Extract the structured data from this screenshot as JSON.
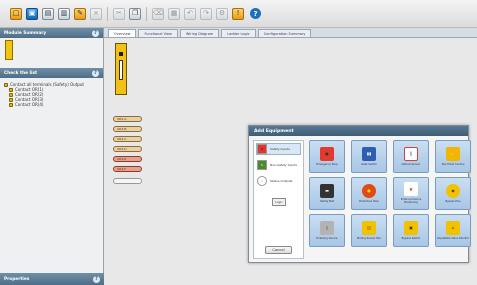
{
  "toolbar": {
    "buttons": [
      "new-project",
      "save",
      "open",
      "print",
      "rename",
      "close",
      "cut",
      "copy",
      "delete",
      "paste",
      "undo",
      "redo",
      "settings",
      "monitor"
    ],
    "help_label": "?"
  },
  "left_panel": {
    "module_summary_title": "Module Summary",
    "check_list_title": "Check the list",
    "tree": [
      {
        "label": "Contact all terminals (Safety) Output"
      },
      {
        "label": "Contact OR(1)"
      },
      {
        "label": "Contact OR(2)"
      },
      {
        "label": "Contact OR(3)"
      },
      {
        "label": "Contact OR(4)"
      }
    ],
    "properties_title": "Properties",
    "help_icon": "?"
  },
  "tabs": [
    {
      "label": "Overview",
      "active": true
    },
    {
      "label": "Functional View",
      "active": false
    },
    {
      "label": "Wiring Diagram",
      "active": false
    },
    {
      "label": "Ladder Logic",
      "active": false
    },
    {
      "label": "Configuration Summary",
      "active": false
    }
  ],
  "slots": [
    {
      "label": "OR4-A",
      "style": "tan"
    },
    {
      "label": "OR4-B",
      "style": "tan"
    },
    {
      "label": "OR4-C",
      "style": "tan"
    },
    {
      "label": "OR4-D",
      "style": "tan"
    },
    {
      "label": "OR4-E",
      "style": "red"
    },
    {
      "label": "OR4-F",
      "style": "red"
    },
    {
      "label": "",
      "style": "white"
    }
  ],
  "dialog": {
    "title": "Add Equipment",
    "categories": [
      {
        "label": "Safety Inputs",
        "selected": true,
        "icon": "safety-input-icon",
        "color": "#e6342a"
      },
      {
        "label": "Non-Safety Inputs",
        "selected": false,
        "icon": "non-safety-input-icon",
        "color": "#4a8c2a"
      },
      {
        "label": "Status Outputs",
        "selected": false,
        "icon": "status-output-icon",
        "color": "#ffffff"
      }
    ],
    "more_label": "Logic",
    "cancel_label": "Cancel",
    "tiles": [
      {
        "label": "Emergency Stop",
        "icon": "emergency-stop-icon",
        "color": "#e23b2d"
      },
      {
        "label": "Gate Switch",
        "icon": "gate-switch-icon",
        "color": "#2b5fb4"
      },
      {
        "label": "Optical Sensor",
        "icon": "optical-sensor-icon",
        "color": "#ffffff"
      },
      {
        "label": "Two Hand Control",
        "icon": "two-hand-control-icon",
        "color": "#f1b600"
      },
      {
        "label": "Safety Mat",
        "icon": "safety-mat-icon",
        "color": "#333333"
      },
      {
        "label": "Protective Stop",
        "icon": "protective-stop-icon",
        "color": "#e04b12"
      },
      {
        "label": "External Device Monitoring",
        "icon": "edm-icon",
        "color": "#d63b22"
      },
      {
        "label": "Bypass Pins",
        "icon": "bypass-pins-icon",
        "color": "#f2c200"
      },
      {
        "label": "Enabling Device",
        "icon": "enabling-device-icon",
        "color": "#b3b3b3"
      },
      {
        "label": "Muting Sensor Pair",
        "icon": "muting-sensor-icon",
        "color": "#f2c200"
      },
      {
        "label": "Bypass Switch",
        "icon": "bypass-switch-icon",
        "color": "#f2c200"
      },
      {
        "label": "Adjustable Valve Monitor",
        "icon": "valve-monitor-icon",
        "color": "#f2c200"
      }
    ]
  },
  "colors": {
    "accent": "#1d6fbc",
    "panel_header": "#587790",
    "device": "#f2c116"
  }
}
